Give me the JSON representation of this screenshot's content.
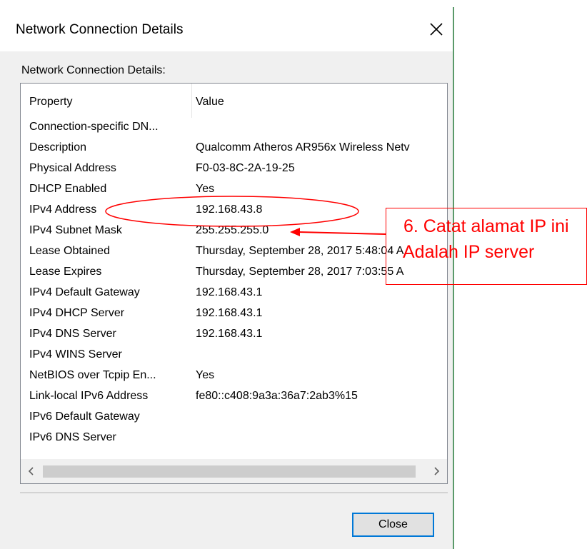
{
  "window": {
    "title": "Network Connection Details",
    "group_label": "Network Connection Details:",
    "close_label": "Close"
  },
  "table": {
    "columns": [
      "Property",
      "Value"
    ],
    "rows": [
      {
        "property": "Connection-specific DN...",
        "value": ""
      },
      {
        "property": "Description",
        "value": "Qualcomm Atheros AR956x Wireless Netv"
      },
      {
        "property": "Physical Address",
        "value": "F0-03-8C-2A-19-25"
      },
      {
        "property": "DHCP Enabled",
        "value": "Yes"
      },
      {
        "property": "IPv4 Address",
        "value": "192.168.43.8"
      },
      {
        "property": "IPv4 Subnet Mask",
        "value": "255.255.255.0"
      },
      {
        "property": "Lease Obtained",
        "value": "Thursday, September 28, 2017 5:48:04 A"
      },
      {
        "property": "Lease Expires",
        "value": "Thursday, September 28, 2017 7:03:55 A"
      },
      {
        "property": "IPv4 Default Gateway",
        "value": "192.168.43.1"
      },
      {
        "property": "IPv4 DHCP Server",
        "value": "192.168.43.1"
      },
      {
        "property": "IPv4 DNS Server",
        "value": "192.168.43.1"
      },
      {
        "property": "IPv4 WINS Server",
        "value": ""
      },
      {
        "property": "NetBIOS over Tcpip En...",
        "value": "Yes"
      },
      {
        "property": "Link-local IPv6 Address",
        "value": "fe80::c408:9a3a:36a7:2ab3%15"
      },
      {
        "property": "IPv6 Default Gateway",
        "value": ""
      },
      {
        "property": "IPv6 DNS Server",
        "value": ""
      }
    ]
  },
  "annotation": {
    "line1": "6. Catat alamat IP ini",
    "line2": "Adalah IP server",
    "color": "#ff0000"
  },
  "icons": {
    "close": "close-icon",
    "scroll_left": "chevron-left-icon",
    "scroll_right": "chevron-right-icon"
  }
}
